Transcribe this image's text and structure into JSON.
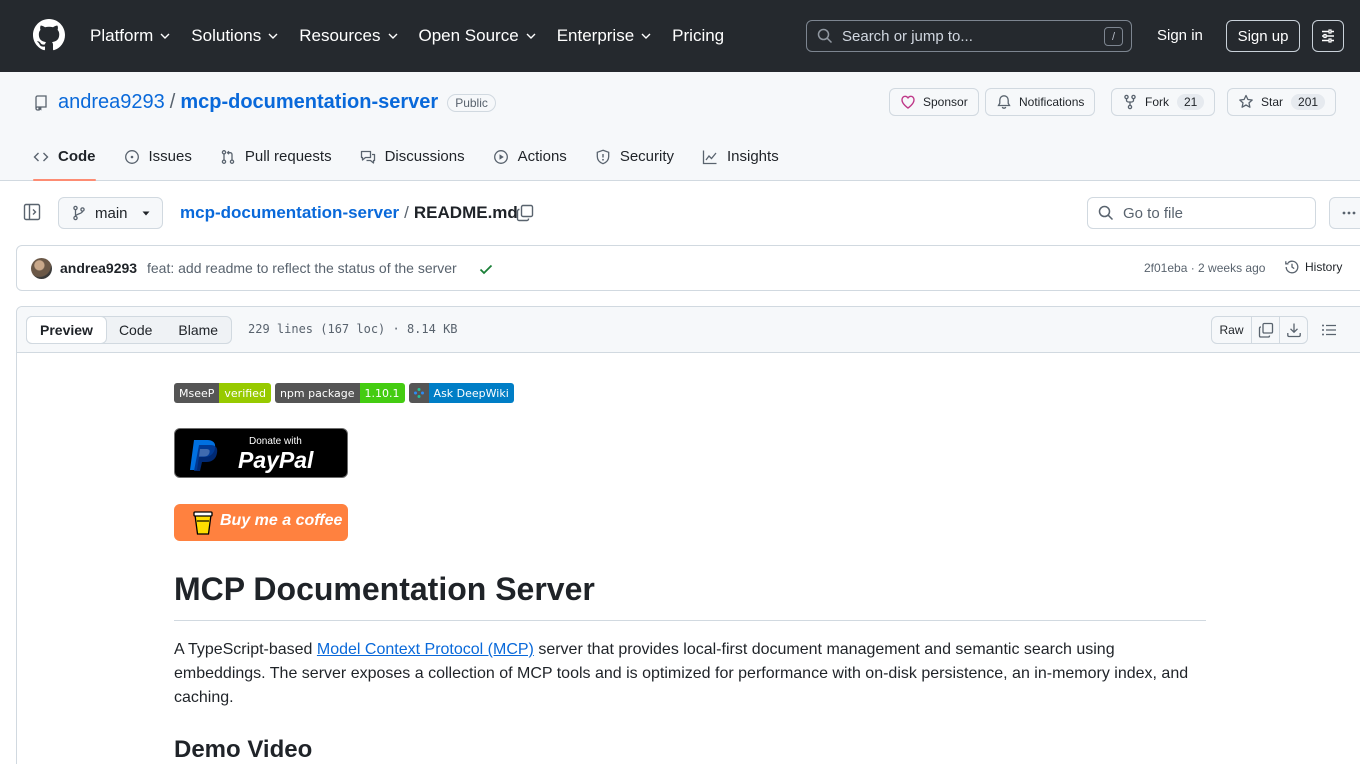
{
  "header": {
    "nav": [
      {
        "label": "Platform",
        "has_menu": true
      },
      {
        "label": "Solutions",
        "has_menu": true
      },
      {
        "label": "Resources",
        "has_menu": true
      },
      {
        "label": "Open Source",
        "has_menu": true
      },
      {
        "label": "Enterprise",
        "has_menu": true
      },
      {
        "label": "Pricing",
        "has_menu": false
      }
    ],
    "search_placeholder": "Search or jump to...",
    "search_shortcut": "/",
    "sign_in": "Sign in",
    "sign_up": "Sign up"
  },
  "repo": {
    "owner": "andrea9293",
    "separator": "/",
    "name": "mcp-documentation-server",
    "visibility": "Public",
    "sponsor_label": "Sponsor",
    "notifications_label": "Notifications",
    "fork_label": "Fork",
    "fork_count": "21",
    "star_label": "Star",
    "star_count": "201",
    "tabs": [
      {
        "label": "Code",
        "icon": "code-icon",
        "active": true
      },
      {
        "label": "Issues",
        "icon": "issue-icon",
        "active": false
      },
      {
        "label": "Pull requests",
        "icon": "pull-request-icon",
        "active": false
      },
      {
        "label": "Discussions",
        "icon": "discussions-icon",
        "active": false
      },
      {
        "label": "Actions",
        "icon": "play-icon",
        "active": false
      },
      {
        "label": "Security",
        "icon": "shield-icon",
        "active": false
      },
      {
        "label": "Insights",
        "icon": "graph-icon",
        "active": false
      }
    ]
  },
  "file": {
    "branch": "main",
    "repo_link": "mcp-documentation-server",
    "separator": "/",
    "filename": "README.md",
    "goto_placeholder": "Go to file"
  },
  "commit": {
    "author": "andrea9293",
    "message": "feat: add readme to reflect the status of the server",
    "meta": "2f01eba · 2 weeks ago",
    "history_label": "History"
  },
  "viewer": {
    "tabs": [
      "Preview",
      "Code",
      "Blame"
    ],
    "active_tab": "Preview",
    "info": "229 lines (167 loc) · 8.14 KB",
    "raw_label": "Raw"
  },
  "readme": {
    "badges": [
      {
        "left": "MseeP",
        "right": "verified"
      },
      {
        "left": "npm package",
        "right": "1.10.1"
      },
      {
        "left": "Ask DeepWiki",
        "right": ""
      }
    ],
    "paypal_small": "Donate with",
    "paypal_word": "PayPal",
    "bmc_text": "Buy me a coffee",
    "title": "MCP Documentation Server",
    "intro_before": "A TypeScript-based ",
    "intro_link": "Model Context Protocol (MCP)",
    "intro_after": " server that provides local-first document management and semantic search using embeddings. The server exposes a collection of MCP tools and is optimized for performance with on-disk persistence, an in-memory index, and caching.",
    "demo_heading": "Demo Video"
  },
  "colors": {
    "header_bg": "#25292e",
    "link": "#0969da",
    "active_tab_underline": "#fd8c73",
    "success": "#1a7f37"
  }
}
